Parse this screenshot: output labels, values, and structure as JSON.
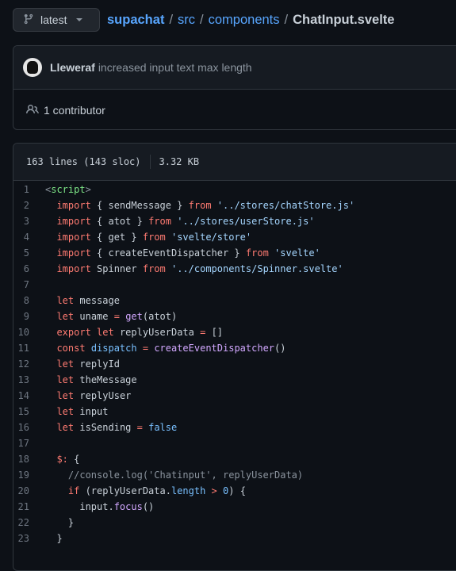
{
  "branch": {
    "label": "latest"
  },
  "breadcrumb": {
    "repo": "supachat",
    "parts": [
      "src",
      "components"
    ],
    "separator": "/",
    "file": "ChatInput.svelte"
  },
  "commit": {
    "author": "Lleweraf",
    "message": "increased input text max length"
  },
  "contributors": {
    "label": "1 contributor"
  },
  "file_info": {
    "lines": "163 lines (143 sloc)",
    "size": "3.32 KB"
  },
  "code_lines": [
    {
      "n": "1",
      "html": "<span class='c'>&lt;</span><span class='t'>script</span><span class='c'>&gt;</span>"
    },
    {
      "n": "2",
      "html": "  <span class='k'>import</span> { sendMessage } <span class='k'>from</span> <span class='s'>'../stores/chatStore.js'</span>"
    },
    {
      "n": "3",
      "html": "  <span class='k'>import</span> { atot } <span class='k'>from</span> <span class='s'>'../stores/userStore.js'</span>"
    },
    {
      "n": "4",
      "html": "  <span class='k'>import</span> { get } <span class='k'>from</span> <span class='s'>'svelte/store'</span>"
    },
    {
      "n": "5",
      "html": "  <span class='k'>import</span> { createEventDispatcher } <span class='k'>from</span> <span class='s'>'svelte'</span>"
    },
    {
      "n": "6",
      "html": "  <span class='k'>import</span> Spinner <span class='k'>from</span> <span class='s'>'../components/Spinner.svelte'</span>"
    },
    {
      "n": "7",
      "html": ""
    },
    {
      "n": "8",
      "html": "  <span class='k'>let</span> message"
    },
    {
      "n": "9",
      "html": "  <span class='k'>let</span> uname <span class='k'>=</span> <span class='f'>get</span>(atot)"
    },
    {
      "n": "10",
      "html": "  <span class='k'>export</span> <span class='k'>let</span> replyUserData <span class='k'>=</span> []"
    },
    {
      "n": "11",
      "html": "  <span class='k'>const</span> <span class='n'>dispatch</span> <span class='k'>=</span> <span class='f'>createEventDispatcher</span>()"
    },
    {
      "n": "12",
      "html": "  <span class='k'>let</span> replyId"
    },
    {
      "n": "13",
      "html": "  <span class='k'>let</span> theMessage"
    },
    {
      "n": "14",
      "html": "  <span class='k'>let</span> replyUser"
    },
    {
      "n": "15",
      "html": "  <span class='k'>let</span> input"
    },
    {
      "n": "16",
      "html": "  <span class='k'>let</span> isSending <span class='k'>=</span> <span class='n'>false</span>"
    },
    {
      "n": "17",
      "html": ""
    },
    {
      "n": "18",
      "html": "  <span class='k'>$:</span> {"
    },
    {
      "n": "19",
      "html": "    <span class='c'>//console.log('Chatinput', replyUserData)</span>"
    },
    {
      "n": "20",
      "html": "    <span class='k'>if</span> (replyUserData.<span class='n'>length</span> <span class='k'>&gt;</span> <span class='n'>0</span>) {"
    },
    {
      "n": "21",
      "html": "      input.<span class='f'>focus</span>()"
    },
    {
      "n": "22",
      "html": "    }"
    },
    {
      "n": "23",
      "html": "  }"
    }
  ],
  "icons": {
    "branch": "git-branch-icon",
    "caret": "triangle-down-icon",
    "people": "people-icon"
  },
  "colors": {
    "background": "#0d1117",
    "link": "#58a6ff",
    "keyword": "#ff7b72",
    "string": "#a5d6ff",
    "tag": "#7ee787",
    "function": "#d2a8ff",
    "constant": "#79c0ff"
  }
}
